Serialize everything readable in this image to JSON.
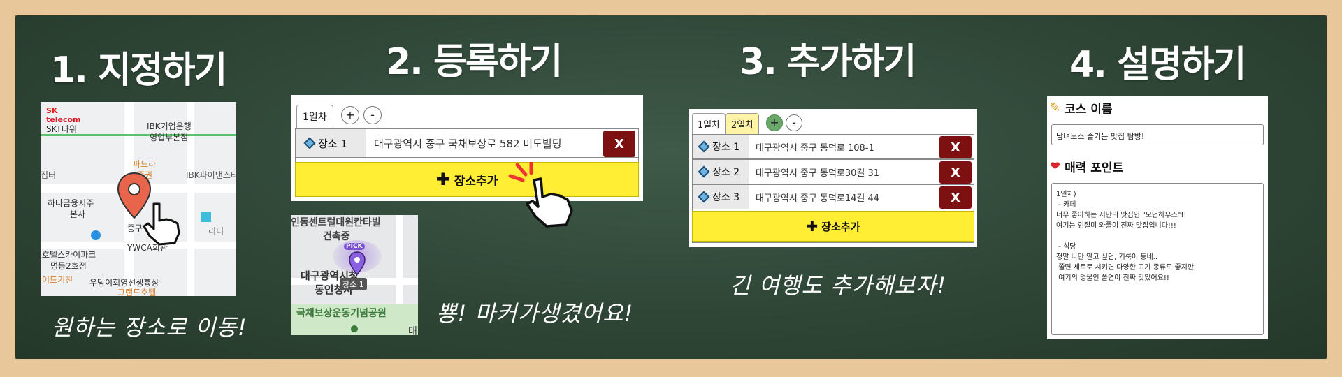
{
  "steps": [
    {
      "title": "1. 지정하기",
      "caption": "원하는 장소로 이동!"
    },
    {
      "title": "2. 등록하기",
      "caption": "뿅! 마커가생겼어요!"
    },
    {
      "title": "3. 추가하기",
      "caption": "긴 여행도 추가해보자!"
    },
    {
      "title": "4. 설명하기"
    }
  ],
  "map1": {
    "labels": [
      "SK telecom",
      "SKT타워",
      "IBK기업은행",
      "영업부본점",
      "파드라",
      "증권",
      "집터",
      "IBK파이낸스타",
      "하나금융지주",
      "본사",
      "호텔스카이파크",
      "명동2호점",
      "YWCA회관",
      "어드키친",
      "우당이회영선생흉상",
      "그랜드호텔",
      "중구",
      "리티"
    ]
  },
  "step2": {
    "tab_label": "1일차",
    "plus": "+",
    "minus": "-",
    "place_label": "장소 1",
    "address": "대구광역시 중구 국채보상로 582 미도빌딩",
    "delete_label": "X",
    "add_label": "장소추가"
  },
  "map2": {
    "labels": [
      "인동센트럴대원칸타빌",
      "건축중",
      "대구광역시청",
      "동인청사",
      "국채보상운동기념공원",
      "대"
    ],
    "pick": "PICK",
    "marker_label": "장소 1"
  },
  "step3": {
    "tabs": [
      "1일차",
      "2일차"
    ],
    "plus": "+",
    "minus": "-",
    "rows": [
      {
        "label": "장소 1",
        "address": "대구광역시 중구 동덕로 108-1"
      },
      {
        "label": "장소 2",
        "address": "대구광역시 중구 동덕로30길 31"
      },
      {
        "label": "장소 3",
        "address": "대구광역시 중구 동덕로14길 44"
      }
    ],
    "delete_label": "X",
    "add_label": "장소추가"
  },
  "step4": {
    "course_name_label": "코스 이름",
    "course_name_value": "남녀노소 즐기는 맛집 탐방!",
    "appeal_label": "매력 포인트",
    "appeal_text": "1일차)\n - 카페\n너무 좋아하는 저만의 맛집인 \"모먼하우스\"!!\n여기는 인절미 와플이 진짜 맛집입니다!!!\n\n - 식당\n정말 나만 알고 싶던, 거룩이 동네..\n 쫄면 세트로 시키면 다양한 고기 종류도 좋지만,\n 여기의 명물인 쫄면이 진짜 맛있어요!!"
  },
  "colors": {
    "board": "#2f4637",
    "frame": "#e8c79a",
    "add_bar": "#ffee33",
    "delete_button": "#7d1010",
    "marker": "#e8654c"
  }
}
